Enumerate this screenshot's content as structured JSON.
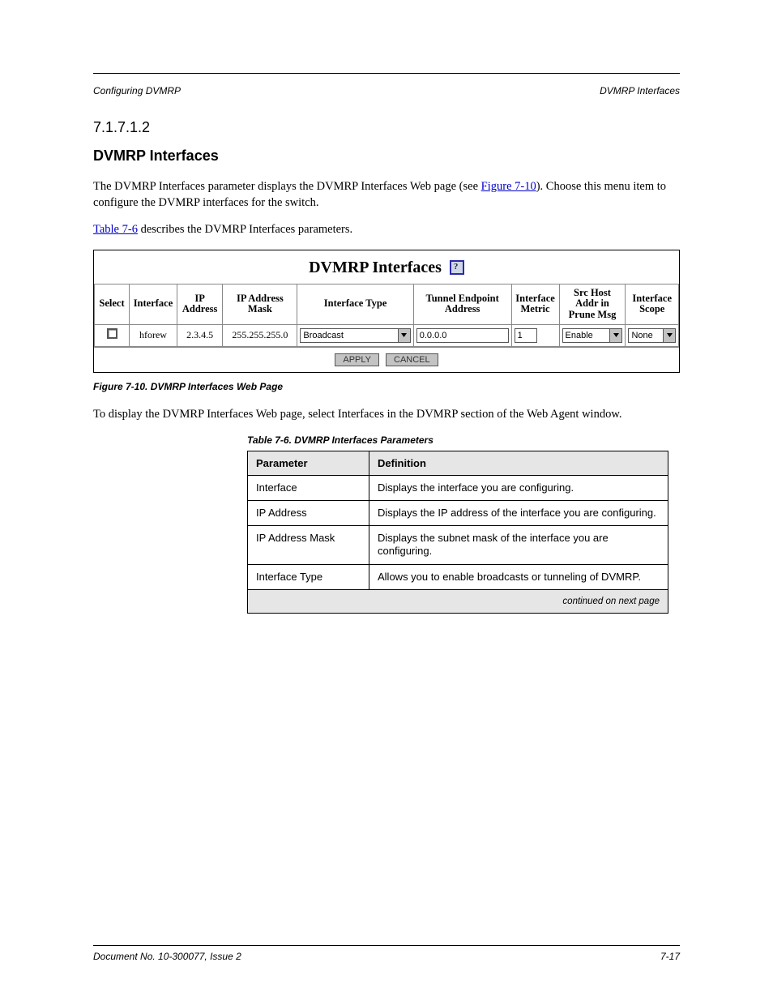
{
  "header": {
    "left": "Configuring DVMRP",
    "right": "DVMRP Interfaces"
  },
  "sec": {
    "num": "7.1.7.1.2",
    "title": "DVMRP Interfaces"
  },
  "para": {
    "p1_a": "The DVMRP Interfaces parameter displays the DVMRP Interfaces Web page (see ",
    "p1_link": "Figure 7-10",
    "p1_b": "). Choose this menu item to configure the DVMRP interfaces for the switch.",
    "p2_a": "Table 7-6",
    "p2_b": " describes the DVMRP Interfaces parameters."
  },
  "fig": {
    "title": "DVMRP Interfaces",
    "headers": {
      "select": "Select",
      "interface": "Interface",
      "ip": "IP Address",
      "mask": "IP Address Mask",
      "type": "Interface Type",
      "tunnel": "Tunnel Endpoint Address",
      "metric": "Interface Metric",
      "src": "Src Host Addr in Prune Msg",
      "scope": "Interface Scope"
    },
    "row": {
      "interface": "hforew",
      "ip": "2.3.4.5",
      "mask": "255.255.255.0",
      "type": "Broadcast",
      "tunnel": "0.0.0.0",
      "metric": "1",
      "src": "Enable",
      "scope": "None"
    },
    "buttons": {
      "apply": "APPLY",
      "cancel": "CANCEL"
    },
    "caption": "Figure 7-10. DVMRP Interfaces Web Page"
  },
  "p3": "To display the DVMRP Interfaces Web page, select Interfaces in the DVMRP section of the Web Agent window.",
  "info": {
    "caption": "Table 7-6. DVMRP Interfaces Parameters  ",
    "headers": {
      "p": "Parameter",
      "d": "Definition"
    },
    "rows": [
      {
        "p": "Interface",
        "d": "Displays the interface you are configuring."
      },
      {
        "p": "IP Address",
        "d": "Displays the IP address of the interface you are configuring."
      },
      {
        "p": "IP Address Mask",
        "d": "Displays the subnet mask of the interface you are configuring."
      },
      {
        "p": "Interface Type",
        "d": "Allows you to enable broadcasts or tunneling of DVMRP."
      }
    ],
    "cont": "continued on next page"
  },
  "footer": {
    "left": "Document No. 10-300077, Issue 2",
    "right": "7-17"
  }
}
